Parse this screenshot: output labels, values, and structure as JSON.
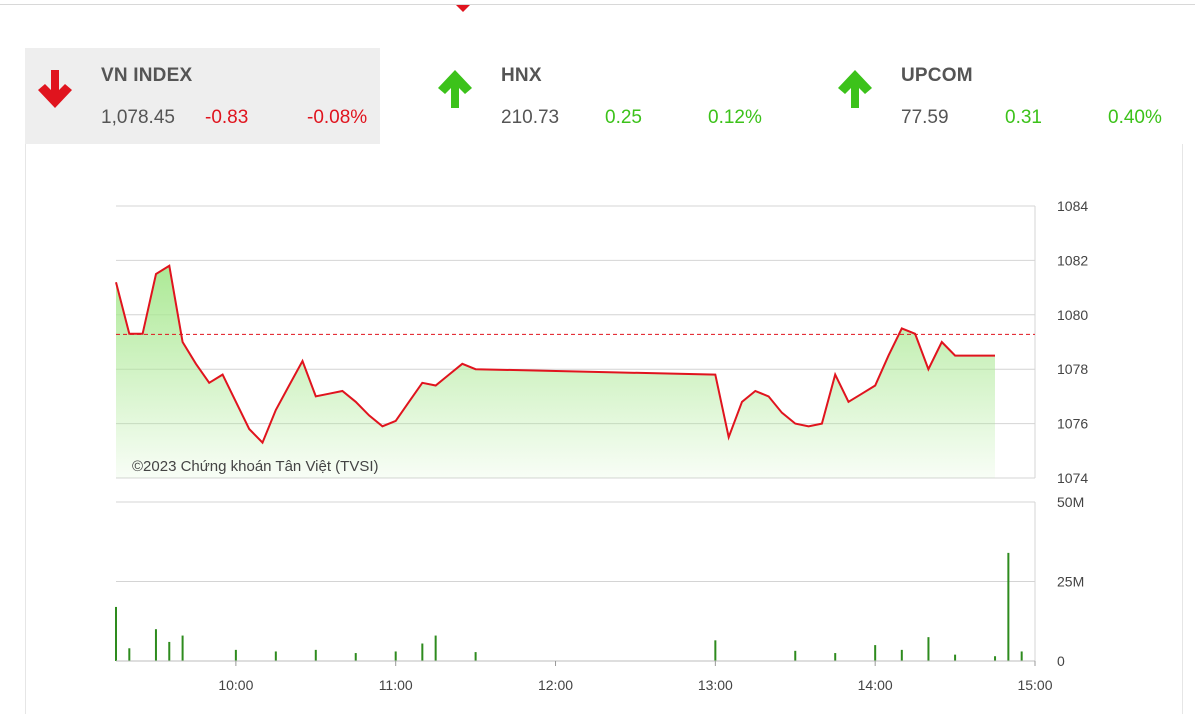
{
  "indices": [
    {
      "name": "VN INDEX",
      "value": "1,078.45",
      "change": "-0.83",
      "pct": "-0.08%",
      "direction": "down"
    },
    {
      "name": "HNX",
      "value": "210.73",
      "change": "0.25",
      "pct": "0.12%",
      "direction": "up"
    },
    {
      "name": "UPCOM",
      "value": "77.59",
      "change": "0.31",
      "pct": "0.40%",
      "direction": "up"
    }
  ],
  "colors": {
    "down": "#e0141e",
    "up": "#3cc21a",
    "line": "#e0141e",
    "area": "#a8e890",
    "volume": "#2e8b1e"
  },
  "chart_data": {
    "type": "line",
    "title": "",
    "watermark": "©2023 Chứng khoán Tân Việt (TVSI)",
    "x_ticks": [
      "10:00",
      "11:00",
      "12:00",
      "13:00",
      "14:00",
      "15:00"
    ],
    "price_axis": {
      "ticks": [
        "1084",
        "1082",
        "1080",
        "1078",
        "1076",
        "1074"
      ],
      "ylim": [
        1074,
        1084
      ]
    },
    "volume_axis": {
      "ticks": [
        "50M",
        "25M",
        "0"
      ],
      "ylim": [
        0,
        50000000
      ]
    },
    "reference_price": 1079.28,
    "series": [
      {
        "kind": "price",
        "x": [
          "09:15",
          "09:20",
          "09:25",
          "09:30",
          "09:35",
          "09:40",
          "09:45",
          "09:50",
          "09:55",
          "10:00",
          "10:05",
          "10:10",
          "10:15",
          "10:20",
          "10:25",
          "10:30",
          "10:35",
          "10:40",
          "10:45",
          "10:50",
          "10:55",
          "11:00",
          "11:05",
          "11:10",
          "11:15",
          "11:20",
          "11:25",
          "11:30",
          "13:00",
          "13:05",
          "13:10",
          "13:15",
          "13:20",
          "13:25",
          "13:30",
          "13:35",
          "13:40",
          "13:45",
          "13:50",
          "13:55",
          "14:00",
          "14:05",
          "14:10",
          "14:15",
          "14:20",
          "14:25",
          "14:30",
          "14:45"
        ],
        "values": [
          1081.2,
          1079.3,
          1079.3,
          1081.5,
          1081.8,
          1079.0,
          1078.2,
          1077.5,
          1077.8,
          1076.8,
          1075.8,
          1075.3,
          1076.5,
          1077.4,
          1078.3,
          1077.0,
          1077.1,
          1077.2,
          1076.8,
          1076.3,
          1075.9,
          1076.1,
          1076.8,
          1077.5,
          1077.4,
          1077.8,
          1078.2,
          1078.0,
          1077.8,
          1075.5,
          1076.8,
          1077.2,
          1077.0,
          1076.4,
          1076.0,
          1075.9,
          1076.0,
          1077.8,
          1076.8,
          1077.1,
          1077.4,
          1078.5,
          1079.5,
          1079.3,
          1078.0,
          1079.0,
          1078.5,
          1078.5
        ]
      },
      {
        "kind": "volume",
        "x": [
          "09:15",
          "09:20",
          "09:30",
          "09:35",
          "09:40",
          "10:00",
          "10:15",
          "10:30",
          "10:45",
          "11:00",
          "11:10",
          "11:15",
          "11:30",
          "13:00",
          "13:30",
          "13:45",
          "14:00",
          "14:10",
          "14:20",
          "14:30",
          "14:45",
          "14:50",
          "14:55"
        ],
        "values": [
          17000000,
          4000000,
          10000000,
          6000000,
          8000000,
          3500000,
          3000000,
          3500000,
          2500000,
          3000000,
          5500000,
          8000000,
          2800000,
          6500000,
          3200000,
          2500000,
          5000000,
          3500000,
          7500000,
          2000000,
          1500000,
          34000000,
          3000000
        ]
      }
    ]
  }
}
